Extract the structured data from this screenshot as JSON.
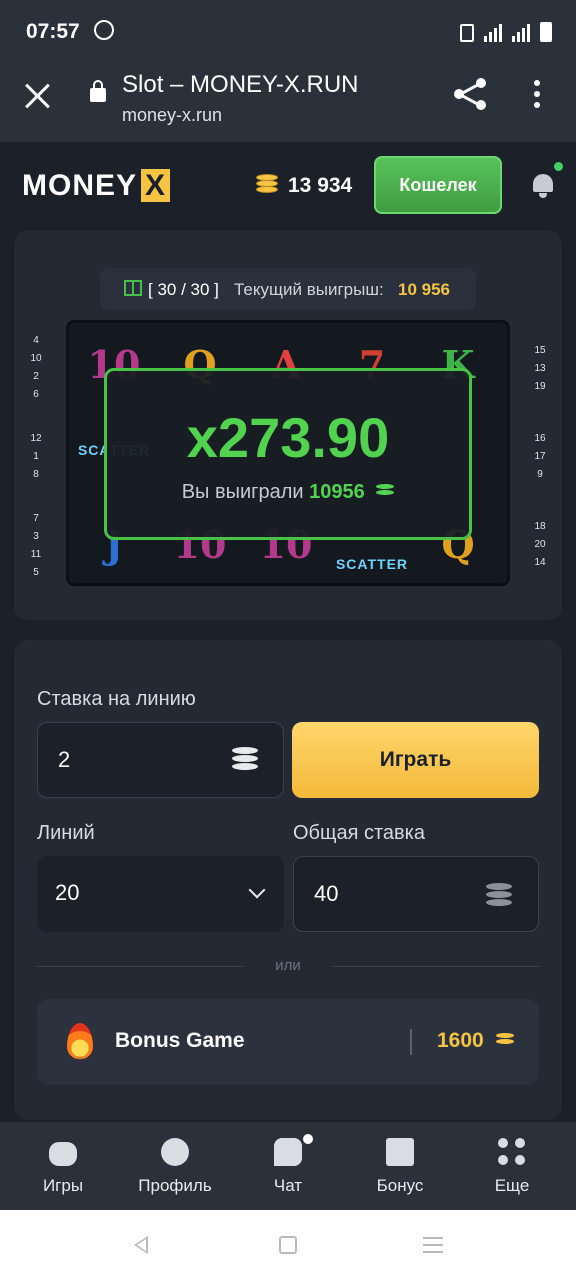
{
  "status_bar": {
    "time": "07:57",
    "icons": [
      "whatsapp-icon",
      "vibrate-icon",
      "signal-lte-icon",
      "signal-icon",
      "battery-icon"
    ]
  },
  "browser": {
    "title": "Slot – MONEY-X.RUN",
    "url": "money-x.run",
    "icons": [
      "close-icon",
      "lock-icon",
      "share-icon",
      "more-vert-icon"
    ]
  },
  "header": {
    "logo_main": "MONEY",
    "logo_x": "X",
    "balance": "13 934",
    "wallet_button": "Кошелек"
  },
  "slot": {
    "free_spins": "[ 30 / 30 ]",
    "current_win_label": "Текущий выигрыш:",
    "current_win_value": "10 956",
    "reels": [
      [
        "10",
        "SCATTER",
        "J"
      ],
      [
        "Q",
        "",
        "10"
      ],
      [
        "A",
        "",
        "10"
      ],
      [
        "7",
        "",
        "SCATTER"
      ],
      [
        "K",
        "",
        "Q"
      ]
    ],
    "left_lines": [
      "4",
      "10",
      "2",
      "6",
      "12",
      "1",
      "8",
      "7",
      "3",
      "11",
      "5"
    ],
    "right_lines": [
      "15",
      "13",
      "19",
      "16",
      "17",
      "9",
      "18",
      "20",
      "14"
    ],
    "win_multiplier": "x273.90",
    "win_text": "Вы выиграли",
    "win_amount": "10956",
    "colors": {
      "win_green": "#51d34f",
      "gold": "#f6c343"
    }
  },
  "bet": {
    "line_bet_label": "Ставка на линию",
    "line_bet_value": "2",
    "play_button": "Играть",
    "lines_label": "Линий",
    "lines_value": "20",
    "total_bet_label": "Общая ставка",
    "total_bet_value": "40",
    "or_text": "или",
    "bonus_title": "Bonus Game",
    "bonus_price": "1600"
  },
  "nav": [
    {
      "label": "Игры",
      "icon": "gamepad-icon"
    },
    {
      "label": "Профиль",
      "icon": "profile-icon"
    },
    {
      "label": "Чат",
      "icon": "chat-icon"
    },
    {
      "label": "Бонус",
      "icon": "archive-icon"
    },
    {
      "label": "Еще",
      "icon": "grid-icon"
    }
  ]
}
